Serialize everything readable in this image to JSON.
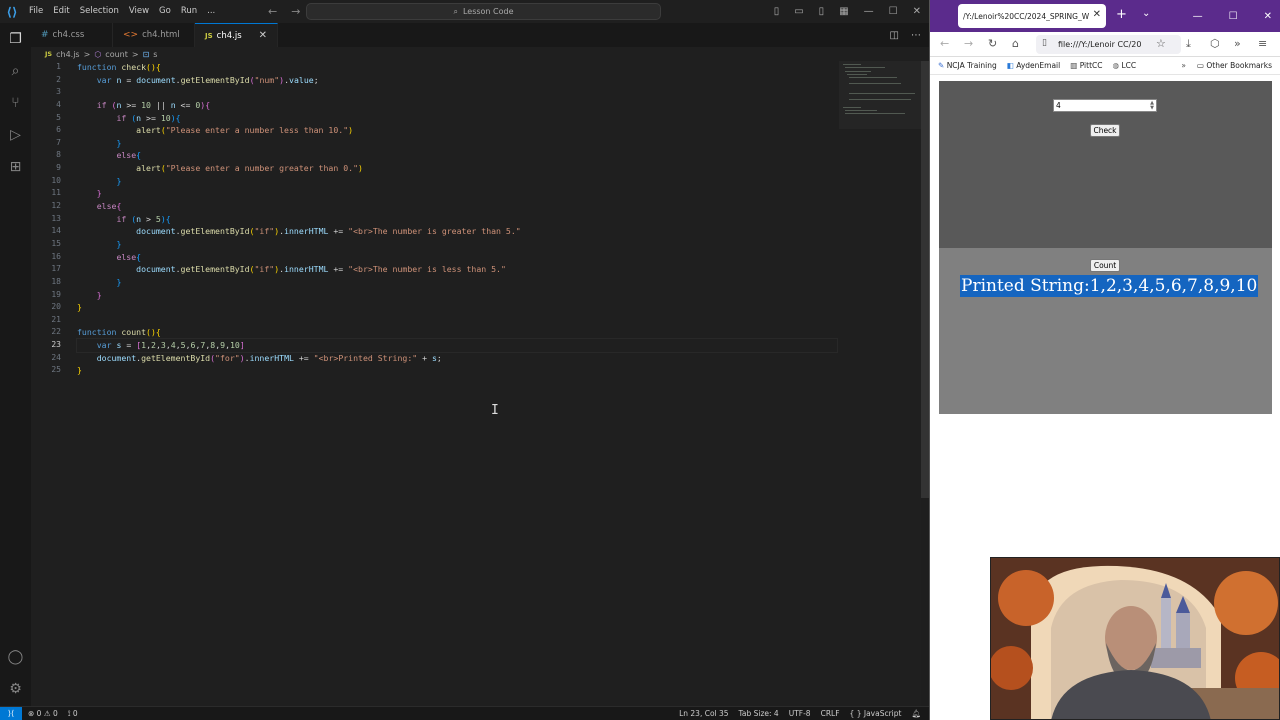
{
  "vscode": {
    "menu": [
      "File",
      "Edit",
      "Selection",
      "View",
      "Go",
      "Run",
      "..."
    ],
    "search_label": "Lesson Code",
    "tabs": [
      {
        "label": "ch4.css",
        "icon": "#"
      },
      {
        "label": "ch4.html",
        "icon": "<>"
      },
      {
        "label": "ch4.js",
        "icon": "JS",
        "active": true
      }
    ],
    "breadcrumb": {
      "file": "ch4.js",
      "sep1": ">",
      "sym1": "count",
      "sep2": ">",
      "sym2": "s"
    },
    "line_numbers": [
      "1",
      "2",
      "3",
      "4",
      "5",
      "6",
      "7",
      "8",
      "9",
      "10",
      "11",
      "12",
      "13",
      "14",
      "15",
      "16",
      "17",
      "18",
      "19",
      "20",
      "21",
      "22",
      "23",
      "24",
      "25"
    ],
    "current_line": 23,
    "status": {
      "errors": "0",
      "warnings": "0",
      "ports": "0",
      "position": "Ln 23, Col 35",
      "tab_size": "Tab Size: 4",
      "encoding": "UTF-8",
      "eol": "CRLF",
      "language": "{ } JavaScript"
    }
  },
  "browser": {
    "tab_title": "/Y:/Lenoir%20CC/2024_SPRING_WE",
    "url": "file:///Y:/Lenoir CC/20",
    "bookmarks": [
      "NCJA Training",
      "AydenEmail",
      "PittCC",
      "LCC"
    ],
    "other_bookmarks": "Other Bookmarks",
    "page": {
      "number_value": "4",
      "check_label": "Check",
      "count_label": "Count",
      "printed_text": "Printed String:1,2,3,4,5,6,7,8,9,10"
    }
  },
  "colors": {
    "accent": "#0078d4",
    "firefox_purple": "#5b2b8c",
    "selection": "#1565c0"
  }
}
